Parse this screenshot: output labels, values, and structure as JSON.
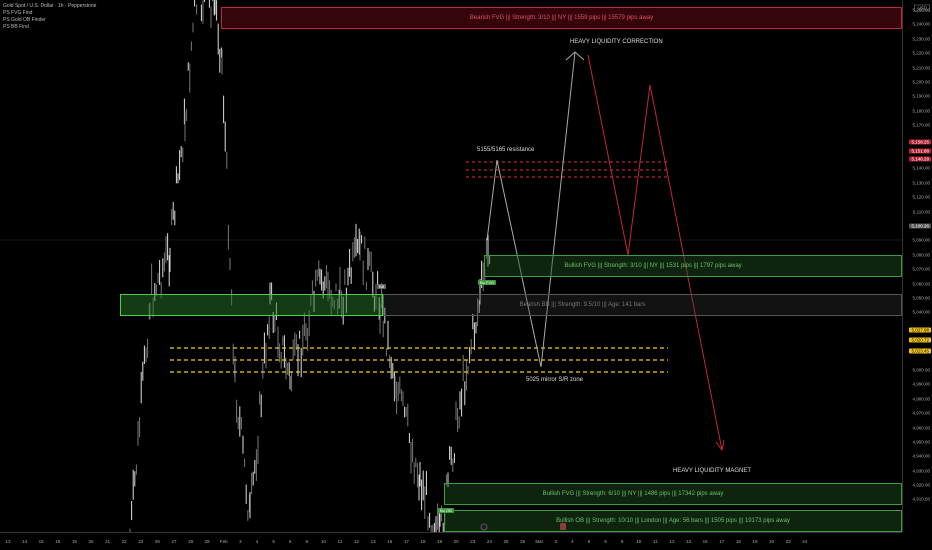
{
  "legend": {
    "symbol": "Gold Spot / U.S. Dollar · 1h · Pepperstone",
    "indicators": [
      "PS FVG Find",
      "PS Gold OB Finder",
      "PS BB Find"
    ]
  },
  "zones": {
    "bearish_fvg": "Bearish FVG ||| Strength: 3/10 ||| NY ||| 1559 pips ||| 15579 pips away",
    "bullish_fvg_1": "Bullish FVG ||| Strength: 3/10 ||| NY ||| 1531 pips ||| 1797 pips away",
    "bearish_bb": "Bearish BB ||| Strength: 9.5/10 ||| Age: 141 bars",
    "bullish_fvg_2": "Bullish FVG ||| Strength: 6/10 ||| NY ||| 1486 pips ||| 17342 pips away",
    "bullish_ob": "Bullish OB ||| Strength: 10/10 ||| London ||| Age: 56 bars ||| 1505 pips ||| 19173 pips away"
  },
  "annotations": {
    "correction": "HEAVY LIQUIDITY CORRECTION",
    "resistance": "5155/5165 resistance",
    "mirror": "5025 mirror S/R zone",
    "magnet": "HEAVY LIQUIDITY MAGNET"
  },
  "mini_labels": {
    "bb": "BB",
    "bu_fvg": "Bu FVG",
    "bu_ob": "Bu OB"
  },
  "price_axis": {
    "currency": "USD",
    "labels": [
      "5,250.00",
      "5,240.00",
      "5,230.00",
      "5,220.00",
      "5,210.00",
      "5,200.00",
      "5,190.00",
      "5,180.00",
      "5,170.00",
      "5,140.00",
      "5,130.00",
      "5,120.00",
      "5,110.00",
      "5,090.00",
      "5,080.00",
      "5,070.00",
      "5,060.00",
      "5,050.00",
      "5,040.00",
      "5,000.00",
      "4,990.00",
      "4,980.00",
      "4,970.00",
      "4,960.00",
      "4,950.00",
      "4,940.00",
      "4,930.00",
      "4,920.00",
      "4,910.50"
    ],
    "tags": [
      {
        "text": "5,158.25",
        "color": "#b22234"
      },
      {
        "text": "5,151.88",
        "color": "#b22234"
      },
      {
        "text": "5,146.29",
        "color": "#b22234"
      },
      {
        "text": "5,100.26",
        "color": "#555555"
      },
      {
        "text": "5,027.98",
        "color": "#f5c518"
      },
      {
        "text": "5,020.72",
        "color": "#f5c518"
      },
      {
        "text": "5,013.45",
        "color": "#f5c518"
      }
    ]
  },
  "time_axis": [
    "13",
    "14",
    "15",
    "16",
    "19",
    "20",
    "21",
    "22",
    "23",
    "26",
    "27",
    "28",
    "29",
    "Feb",
    "3",
    "4",
    "5",
    "6",
    "9",
    "10",
    "11",
    "12",
    "13",
    "16",
    "17",
    "18",
    "19",
    "20",
    "23",
    "24",
    "25",
    "26",
    "Mar",
    "3",
    "4",
    "5",
    "6",
    "9",
    "10",
    "11",
    "12",
    "13",
    "16",
    "17",
    "18",
    "19",
    "20",
    "23",
    "24"
  ],
  "colors": {
    "bear": "#e0304a",
    "bull": "#4caf50",
    "yellow": "#f5c518"
  }
}
